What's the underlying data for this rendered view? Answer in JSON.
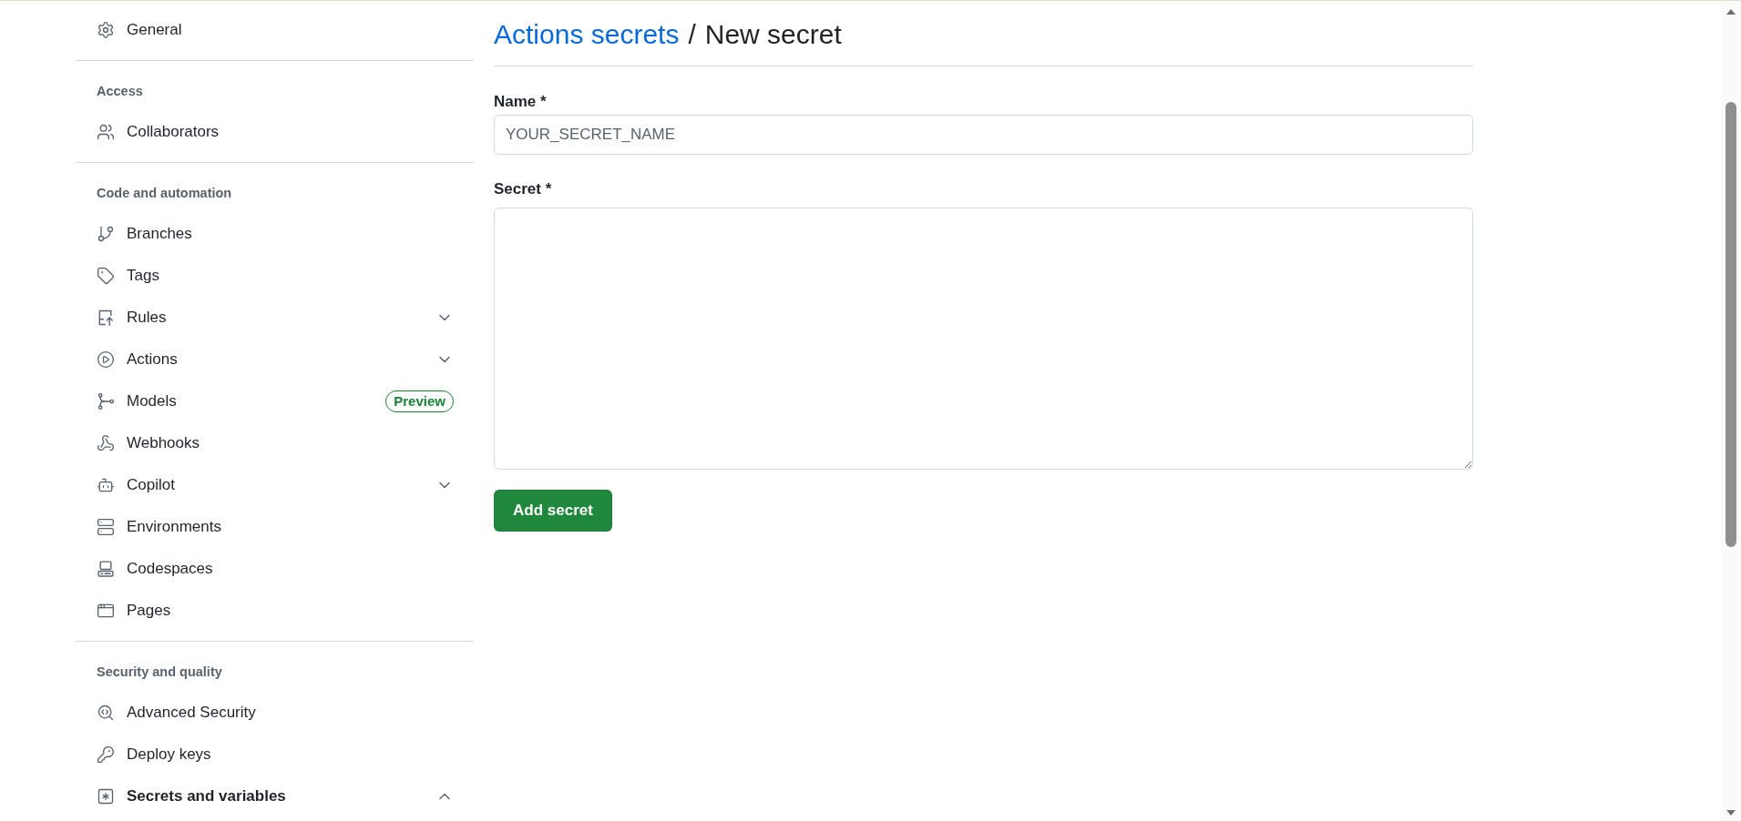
{
  "sidebar": {
    "sections": [
      {
        "items": [
          {
            "label": "General",
            "kind": "link",
            "selected": false
          }
        ]
      },
      {
        "heading": "Access",
        "items": [
          {
            "label": "Collaborators",
            "kind": "link",
            "selected": false
          }
        ]
      },
      {
        "heading": "Code and automation",
        "items": [
          {
            "label": "Branches",
            "kind": "link",
            "selected": false
          },
          {
            "label": "Tags",
            "kind": "link",
            "selected": false
          },
          {
            "label": "Rules",
            "kind": "group",
            "expanded": false,
            "selected": false
          },
          {
            "label": "Actions",
            "kind": "group",
            "expanded": false,
            "selected": false
          },
          {
            "label": "Models",
            "kind": "link",
            "badge": "Preview",
            "selected": false
          },
          {
            "label": "Webhooks",
            "kind": "link",
            "selected": false
          },
          {
            "label": "Copilot",
            "kind": "group",
            "expanded": false,
            "selected": false
          },
          {
            "label": "Environments",
            "kind": "link",
            "selected": false
          },
          {
            "label": "Codespaces",
            "kind": "link",
            "selected": false
          },
          {
            "label": "Pages",
            "kind": "link",
            "selected": false
          }
        ]
      },
      {
        "heading": "Security and quality",
        "items": [
          {
            "label": "Advanced Security",
            "kind": "link",
            "selected": false
          },
          {
            "label": "Deploy keys",
            "kind": "link",
            "selected": false
          },
          {
            "label": "Secrets and variables",
            "kind": "group",
            "expanded": true,
            "selected": true
          }
        ]
      }
    ]
  },
  "main": {
    "breadcrumb": {
      "link": "Actions secrets",
      "separator": "/",
      "current": "New secret"
    },
    "fields": [
      {
        "kind": "input",
        "label": "Name *",
        "placeholder": "YOUR_SECRET_NAME"
      },
      {
        "kind": "textarea",
        "label": "Secret *"
      }
    ],
    "submit_button": {
      "label": "Add secret"
    }
  }
}
